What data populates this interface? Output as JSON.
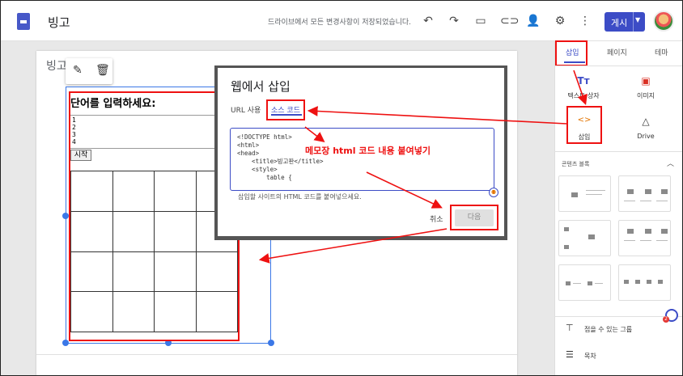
{
  "topbar": {
    "site_title": "빙고",
    "save_status": "드라이브에서 모든 변경사항이 저장되었습니다.",
    "publish_label": "게시",
    "icons": [
      "undo-icon",
      "redo-icon",
      "preview-icon",
      "link-icon",
      "share-icon",
      "settings-icon",
      "more-icon"
    ]
  },
  "page": {
    "title": "빙고"
  },
  "bingo": {
    "heading": "단어를 입력하세요:",
    "textarea_lines": [
      "1",
      "2",
      "3",
      "4"
    ],
    "start_label": "시작",
    "grid_rows": 4,
    "grid_cols": 4
  },
  "dialog": {
    "title": "웹에서 삽입",
    "tab_url": "URL 사용",
    "tab_source": "소스 코드",
    "code": "<!DOCTYPE html>\n<html>\n<head>\n    <title>빙고판</title>\n    <style>\n        table {",
    "hint": "삽입할 사이트의 HTML 코드를 붙여넣으세요.",
    "cancel_label": "취소",
    "next_label": "다음"
  },
  "annotation": {
    "text": "메모장 html 코드 내용 붙여넣기",
    "color": "#ee1111"
  },
  "panel": {
    "tabs": [
      "삽입",
      "페이지",
      "테마"
    ],
    "tools": [
      {
        "label": "텍스트 상자",
        "icon": "text-box-icon"
      },
      {
        "label": "이미지",
        "icon": "image-icon"
      },
      {
        "label": "삽입",
        "icon": "embed-icon"
      },
      {
        "label": "Drive",
        "icon": "drive-icon"
      }
    ],
    "section_title": "콘텐츠 블록",
    "bottom_items": [
      {
        "label": "접을 수 있는 그룹",
        "icon": "collapsible-icon"
      },
      {
        "label": "목차",
        "icon": "toc-icon"
      }
    ]
  },
  "colors": {
    "accent": "#3c4cc6",
    "annotation_red": "#ee1111",
    "selection_blue": "#3b78e7"
  }
}
